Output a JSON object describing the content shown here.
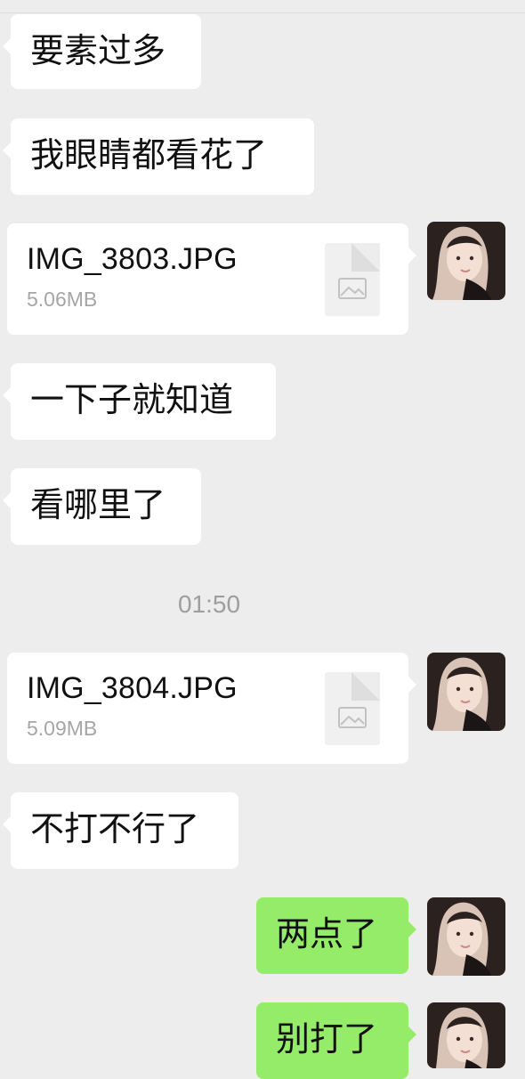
{
  "messages": {
    "m1": "要素过多",
    "m2": "我眼睛都看花了",
    "file1": {
      "name": "IMG_3803.JPG",
      "size": "5.06MB"
    },
    "m3": "一下子就知道",
    "m4": "看哪里了",
    "time": "01:50",
    "file2": {
      "name": "IMG_3804.JPG",
      "size": "5.09MB"
    },
    "m5": "不打不行了",
    "m6": "两点了",
    "m7": "别打了"
  },
  "colors": {
    "background": "#ededed",
    "incoming_bubble": "#ffffff",
    "outgoing_bubble": "#95ec69"
  },
  "icons": {
    "file": "image-file-icon",
    "avatar": "user-avatar"
  }
}
